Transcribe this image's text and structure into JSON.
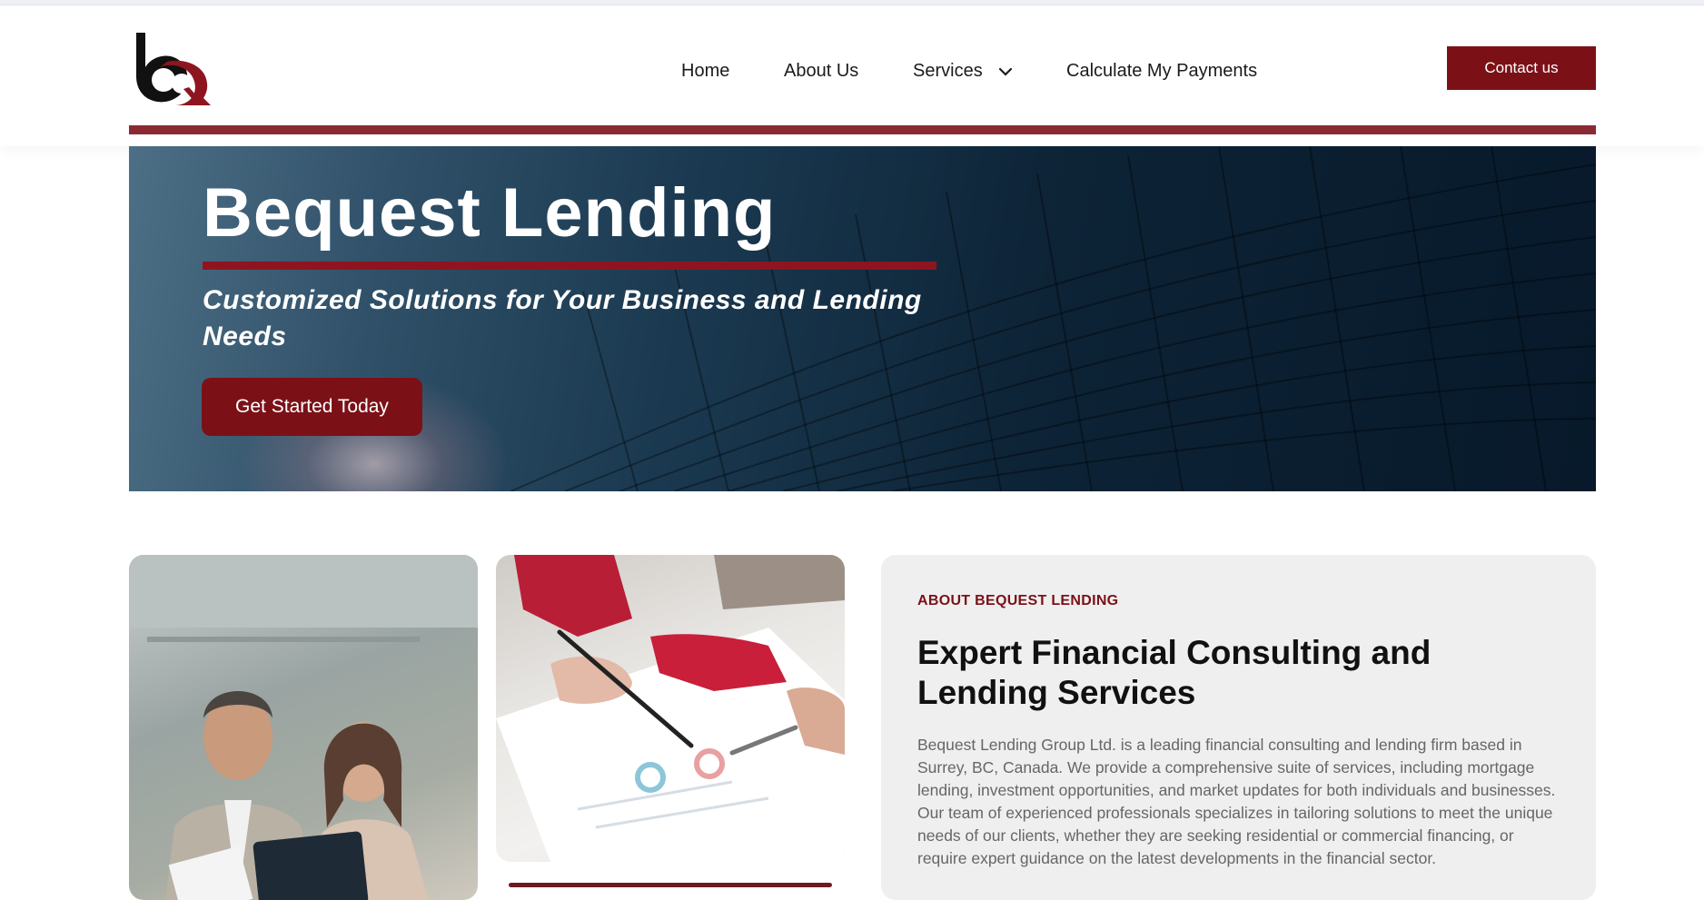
{
  "brand": {
    "primary": "#7b1117",
    "bar": "#8a2a33"
  },
  "header": {
    "logo_icon": "bq-logo-icon",
    "nav": [
      {
        "label": "Home"
      },
      {
        "label": "About Us"
      },
      {
        "label": "Services",
        "icon": "chevron-down-icon"
      },
      {
        "label": "Calculate My Payments"
      }
    ],
    "contact_label": "Contact us"
  },
  "hero": {
    "title": "Bequest Lending",
    "subtitle": "Customized Solutions for Your Business and Lending Needs",
    "cta_label": "Get Started Today"
  },
  "about": {
    "kicker": "ABOUT BEQUEST LENDING",
    "title": "Expert Financial Consulting and Lending Services",
    "body": "Bequest Lending Group Ltd. is a leading financial consulting and lending firm based in Surrey, BC, Canada. We provide a comprehensive suite of services, including mortgage lending, investment opportunities, and market updates for both individuals and businesses. Our team of experienced professionals specializes in tailoring solutions to meet the unique needs of our clients, whether they are seeking residential or commercial financing, or require expert guidance on the latest developments in the financial sector."
  }
}
